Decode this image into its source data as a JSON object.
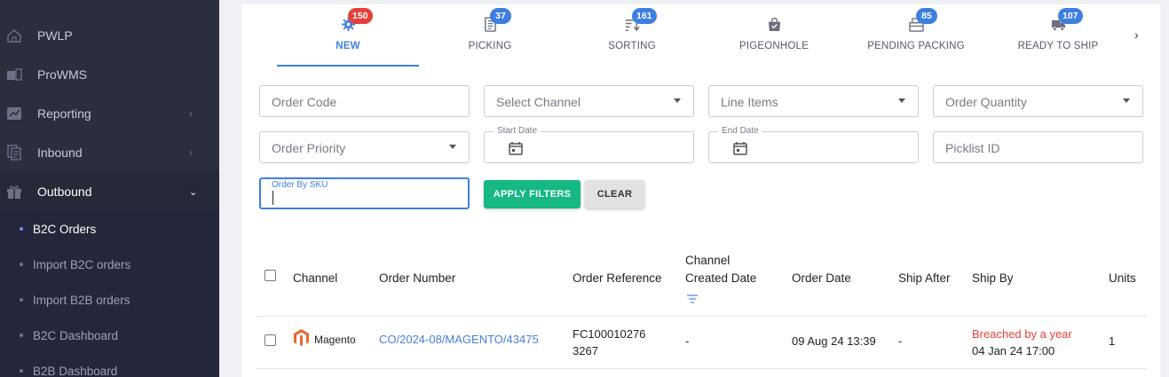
{
  "sidebar": {
    "items": [
      {
        "label": "PWLP",
        "icon": "home-icon"
      },
      {
        "label": "ProWMS",
        "icon": "warehouse-icon"
      },
      {
        "label": "Reporting",
        "icon": "chart-icon"
      },
      {
        "label": "Inbound",
        "icon": "document-icon"
      },
      {
        "label": "Outbound",
        "icon": "gift-icon"
      }
    ],
    "submenu": [
      {
        "label": "B2C Orders"
      },
      {
        "label": "Import B2C orders"
      },
      {
        "label": "Import B2B orders"
      },
      {
        "label": "B2C Dashboard"
      },
      {
        "label": "B2B Dashboard"
      }
    ]
  },
  "tabs": [
    {
      "label": "NEW",
      "badge": "150",
      "icon": "settings-icon"
    },
    {
      "label": "PICKING",
      "badge": "37",
      "icon": "list-icon"
    },
    {
      "label": "SORTING",
      "badge": "161",
      "icon": "sort-icon"
    },
    {
      "label": "PIGEONHOLE",
      "badge": "",
      "icon": "bag-icon"
    },
    {
      "label": "PENDING PACKING",
      "badge": "85",
      "icon": "box-icon"
    },
    {
      "label": "READY TO SHIP",
      "badge": "107",
      "icon": "truck-icon"
    }
  ],
  "filters": {
    "order_code": "Order Code",
    "select_channel": "Select Channel",
    "line_items": "Line Items",
    "order_quantity": "Order Quantity",
    "order_priority": "Order Priority",
    "start_date": "Start Date",
    "end_date": "End Date",
    "picklist_id": "Picklist ID",
    "order_by_sku": "Order By SKU",
    "apply_label": "APPLY FILTERS",
    "clear_label": "CLEAR"
  },
  "table": {
    "headers": {
      "channel": "Channel",
      "order_number": "Order Number",
      "order_reference": "Order Reference",
      "channel_created_date_1": "Channel",
      "channel_created_date_2": "Created Date",
      "order_date": "Order Date",
      "ship_after": "Ship After",
      "ship_by": "Ship By",
      "units": "Units"
    },
    "rows": [
      {
        "channel": "Magento",
        "order_number": "CO/2024-08/MAGENTO/43475",
        "order_reference_1": "FC100010276",
        "order_reference_2": "3267",
        "channel_created_date": "-",
        "order_date": "09 Aug 24 13:39",
        "ship_after": "-",
        "ship_by_status": "Breached by a year",
        "ship_by_date": "04 Jan 24 17:00",
        "units": "1"
      }
    ]
  },
  "colors": {
    "accent": "#3d7fe0",
    "badge_active": "#e5413a",
    "apply_button": "#16b884",
    "sidebar_bg": "#2b2e3d",
    "breached": "#e5413a"
  }
}
